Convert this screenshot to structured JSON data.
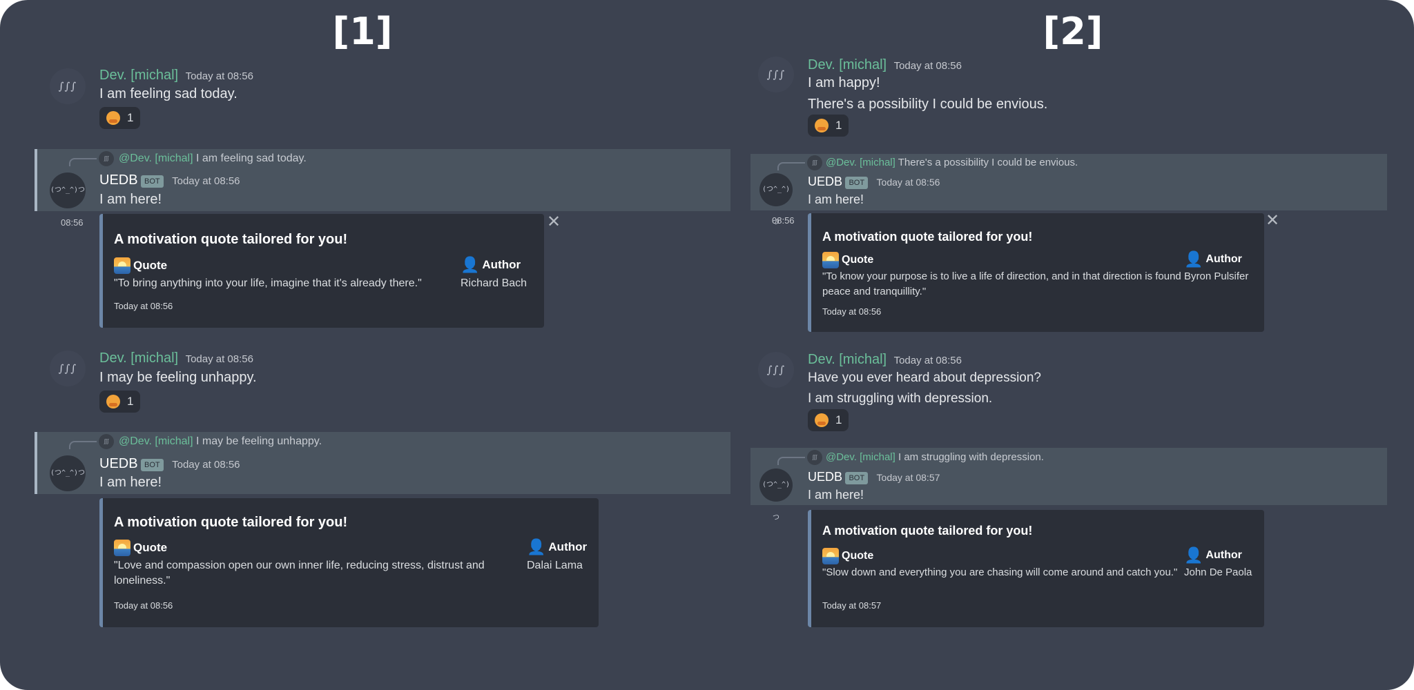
{
  "panels": [
    {
      "label": "[1]",
      "messages": [
        {
          "author": "Dev. [michal]",
          "timestamp": "Today at 08:56",
          "avatar": "∫∫∫",
          "lines": [
            "I am feeling sad today."
          ],
          "reaction": {
            "emoji": "hugging-face",
            "count": "1"
          }
        },
        {
          "reply_mention": "@Dev. [michal]",
          "reply_text": "I am feeling sad today.",
          "author": "UEDB",
          "bot_tag": "BOT",
          "timestamp": "Today at 08:56",
          "avatar": "(つ^_^)つ",
          "text": "I am here!",
          "hover_time": "08:56",
          "embed": {
            "title": "A motivation quote tailored for you!",
            "quote_label": "Quote",
            "author_label": "Author",
            "quote": "\"To bring anything into your life, imagine that it's already there.\"",
            "author": "Richard Bach",
            "footer": "Today at 08:56"
          }
        },
        {
          "author": "Dev. [michal]",
          "timestamp": "Today at 08:56",
          "avatar": "∫∫∫",
          "lines": [
            "I may be feeling unhappy."
          ],
          "reaction": {
            "emoji": "hugging-face",
            "count": "1"
          }
        },
        {
          "reply_mention": "@Dev. [michal]",
          "reply_text": "I may be feeling unhappy.",
          "author": "UEDB",
          "bot_tag": "BOT",
          "timestamp": "Today at 08:56",
          "avatar": "(つ^_^)つ",
          "text": "I am here!",
          "embed": {
            "title": "A motivation quote tailored for you!",
            "quote_label": "Quote",
            "author_label": "Author",
            "quote": "\"Love and compassion open our own inner life, reducing stress, distrust and loneliness.\"",
            "author": "Dalai Lama",
            "footer": "Today at 08:56"
          }
        }
      ]
    },
    {
      "label": "[2]",
      "messages": [
        {
          "author": "Dev. [michal]",
          "timestamp": "Today at 08:56",
          "avatar": "∫∫∫",
          "lines": [
            "I am happy!",
            "There's a possibility I could be envious."
          ],
          "reaction": {
            "emoji": "hugging-face",
            "count": "1"
          }
        },
        {
          "reply_mention": "@Dev. [michal]",
          "reply_text": "There's a possibility I could be envious.",
          "author": "UEDB",
          "bot_tag": "BOT",
          "timestamp": "Today at 08:56",
          "avatar": "(つ^_^)つ",
          "text": "I am here!",
          "hover_time": "08:56",
          "embed": {
            "title": "A motivation quote tailored for you!",
            "quote_label": "Quote",
            "author_label": "Author",
            "quote": "\"To know your purpose is to live a life of direction, and in that direction is found peace and tranquillity.\"",
            "author": "Byron Pulsifer",
            "footer": "Today at 08:56"
          }
        },
        {
          "author": "Dev. [michal]",
          "timestamp": "Today at 08:56",
          "avatar": "∫∫∫",
          "lines": [
            "Have you ever heard about depression?",
            "I am struggling with depression."
          ],
          "reaction": {
            "emoji": "hugging-face",
            "count": "1"
          }
        },
        {
          "reply_mention": "@Dev. [michal]",
          "reply_text": "I am struggling with depression.",
          "author": "UEDB",
          "bot_tag": "BOT",
          "timestamp": "Today at 08:57",
          "avatar": "(つ^_^)つ",
          "text": "I am here!",
          "embed": {
            "title": "A motivation quote tailored for you!",
            "quote_label": "Quote",
            "author_label": "Author",
            "quote": "\"Slow down and everything you are chasing will come around and catch you.\"",
            "author": "John De Paola",
            "footer": "Today at 08:57"
          }
        }
      ]
    }
  ],
  "colors": {
    "background": "#3c4250",
    "username": "#6bbf9a",
    "embed_bg": "#2b2f38",
    "embed_border": "#6c86a7",
    "highlight": "#4a545f"
  }
}
